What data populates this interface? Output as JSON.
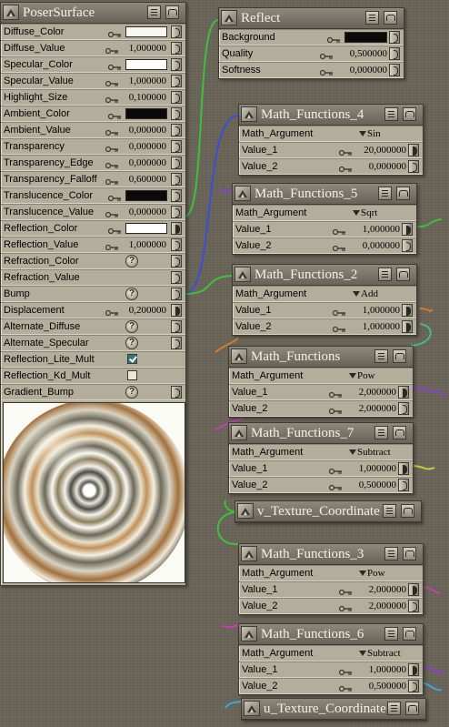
{
  "poser_surface": {
    "title": "PoserSurface",
    "rows": [
      {
        "label": "Diffuse_Color",
        "kind": "color",
        "color": "#f7f7f1"
      },
      {
        "label": "Diffuse_Value",
        "kind": "num",
        "value": "1,000000"
      },
      {
        "label": "Specular_Color",
        "kind": "color",
        "color": "#ffffff"
      },
      {
        "label": "Specular_Value",
        "kind": "num",
        "value": "1,000000"
      },
      {
        "label": "Highlight_Size",
        "kind": "num",
        "value": "0,100000"
      },
      {
        "label": "Ambient_Color",
        "kind": "color",
        "color": "#0a0a0a"
      },
      {
        "label": "Ambient_Value",
        "kind": "num",
        "value": "0,000000"
      },
      {
        "label": "Transparency",
        "kind": "num",
        "value": "0,000000"
      },
      {
        "label": "Transparency_Edge",
        "kind": "num",
        "value": "0,000000"
      },
      {
        "label": "Transparency_Falloff",
        "kind": "num",
        "value": "0,600000"
      },
      {
        "label": "Translucence_Color",
        "kind": "color",
        "color": "#0a0a0a"
      },
      {
        "label": "Translucence_Value",
        "kind": "num",
        "value": "0,000000"
      },
      {
        "label": "Reflection_Color",
        "kind": "color",
        "color": "#ffffff",
        "linked": true
      },
      {
        "label": "Reflection_Value",
        "kind": "num",
        "value": "1,000000"
      },
      {
        "label": "Refraction_Color",
        "kind": "help"
      },
      {
        "label": "Refraction_Value",
        "kind": "empty"
      },
      {
        "label": "Bump",
        "kind": "help"
      },
      {
        "label": "Displacement",
        "kind": "num",
        "value": "0,200000",
        "linked": true
      },
      {
        "label": "Alternate_Diffuse",
        "kind": "help"
      },
      {
        "label": "Alternate_Specular",
        "kind": "help"
      },
      {
        "label": "Reflection_Lite_Mult",
        "kind": "check",
        "checked": true
      },
      {
        "label": "Reflection_Kd_Mult",
        "kind": "check",
        "checked": false
      },
      {
        "label": "Gradient_Bump",
        "kind": "help"
      }
    ]
  },
  "nodes": [
    {
      "id": "reflect",
      "title": "Reflect",
      "rows": [
        {
          "label": "Background",
          "kind": "color",
          "color": "#0a0a0a"
        },
        {
          "label": "Quality",
          "kind": "num",
          "value": "0,500000"
        },
        {
          "label": "Softness",
          "kind": "num",
          "value": "0,000000"
        }
      ]
    },
    {
      "id": "mf4",
      "title": "Math_Functions_4",
      "rows": [
        {
          "label": "Math_Argument",
          "kind": "drop",
          "value": "Sin"
        },
        {
          "label": "Value_1",
          "kind": "num",
          "value": "20,000000",
          "linked": true
        },
        {
          "label": "Value_2",
          "kind": "num",
          "value": "0,000000"
        }
      ]
    },
    {
      "id": "mf5",
      "title": "Math_Functions_5",
      "rows": [
        {
          "label": "Math_Argument",
          "kind": "drop",
          "value": "Sqrt"
        },
        {
          "label": "Value_1",
          "kind": "num",
          "value": "1,000000",
          "linked": true
        },
        {
          "label": "Value_2",
          "kind": "num",
          "value": "0,000000"
        }
      ]
    },
    {
      "id": "mf2",
      "title": "Math_Functions_2",
      "rows": [
        {
          "label": "Math_Argument",
          "kind": "drop",
          "value": "Add"
        },
        {
          "label": "Value_1",
          "kind": "num",
          "value": "1,000000",
          "linked": true
        },
        {
          "label": "Value_2",
          "kind": "num",
          "value": "1,000000",
          "linked": true
        }
      ]
    },
    {
      "id": "mf",
      "title": "Math_Functions",
      "rows": [
        {
          "label": "Math_Argument",
          "kind": "drop",
          "value": "Pow"
        },
        {
          "label": "Value_1",
          "kind": "num",
          "value": "2,000000",
          "linked": true
        },
        {
          "label": "Value_2",
          "kind": "num",
          "value": "2,000000"
        }
      ]
    },
    {
      "id": "mf7",
      "title": "Math_Functions_7",
      "rows": [
        {
          "label": "Math_Argument",
          "kind": "drop",
          "value": "Subtract"
        },
        {
          "label": "Value_1",
          "kind": "num",
          "value": "1,000000",
          "linked": true
        },
        {
          "label": "Value_2",
          "kind": "num",
          "value": "0,500000"
        }
      ]
    },
    {
      "id": "vtex",
      "title": "v_Texture_Coordinate",
      "rows": []
    },
    {
      "id": "mf3",
      "title": "Math_Functions_3",
      "rows": [
        {
          "label": "Math_Argument",
          "kind": "drop",
          "value": "Pow"
        },
        {
          "label": "Value_1",
          "kind": "num",
          "value": "2,000000",
          "linked": true
        },
        {
          "label": "Value_2",
          "kind": "num",
          "value": "2,000000"
        }
      ]
    },
    {
      "id": "mf6",
      "title": "Math_Functions_6",
      "rows": [
        {
          "label": "Math_Argument",
          "kind": "drop",
          "value": "Subtract"
        },
        {
          "label": "Value_1",
          "kind": "num",
          "value": "1,000000",
          "linked": true
        },
        {
          "label": "Value_2",
          "kind": "num",
          "value": "0,500000"
        }
      ]
    },
    {
      "id": "utex",
      "title": "u_Texture_Coordinate",
      "rows": []
    }
  ],
  "wire_colors": {
    "green": "#3fbf3f",
    "blue": "#3a4fd8",
    "purple": "#8a3fd0",
    "orange": "#d97a2a",
    "teal": "#3fb8a0",
    "magenta": "#c43fb0",
    "yellow_green": "#b8d43a",
    "cyan": "#3aa8d8"
  }
}
